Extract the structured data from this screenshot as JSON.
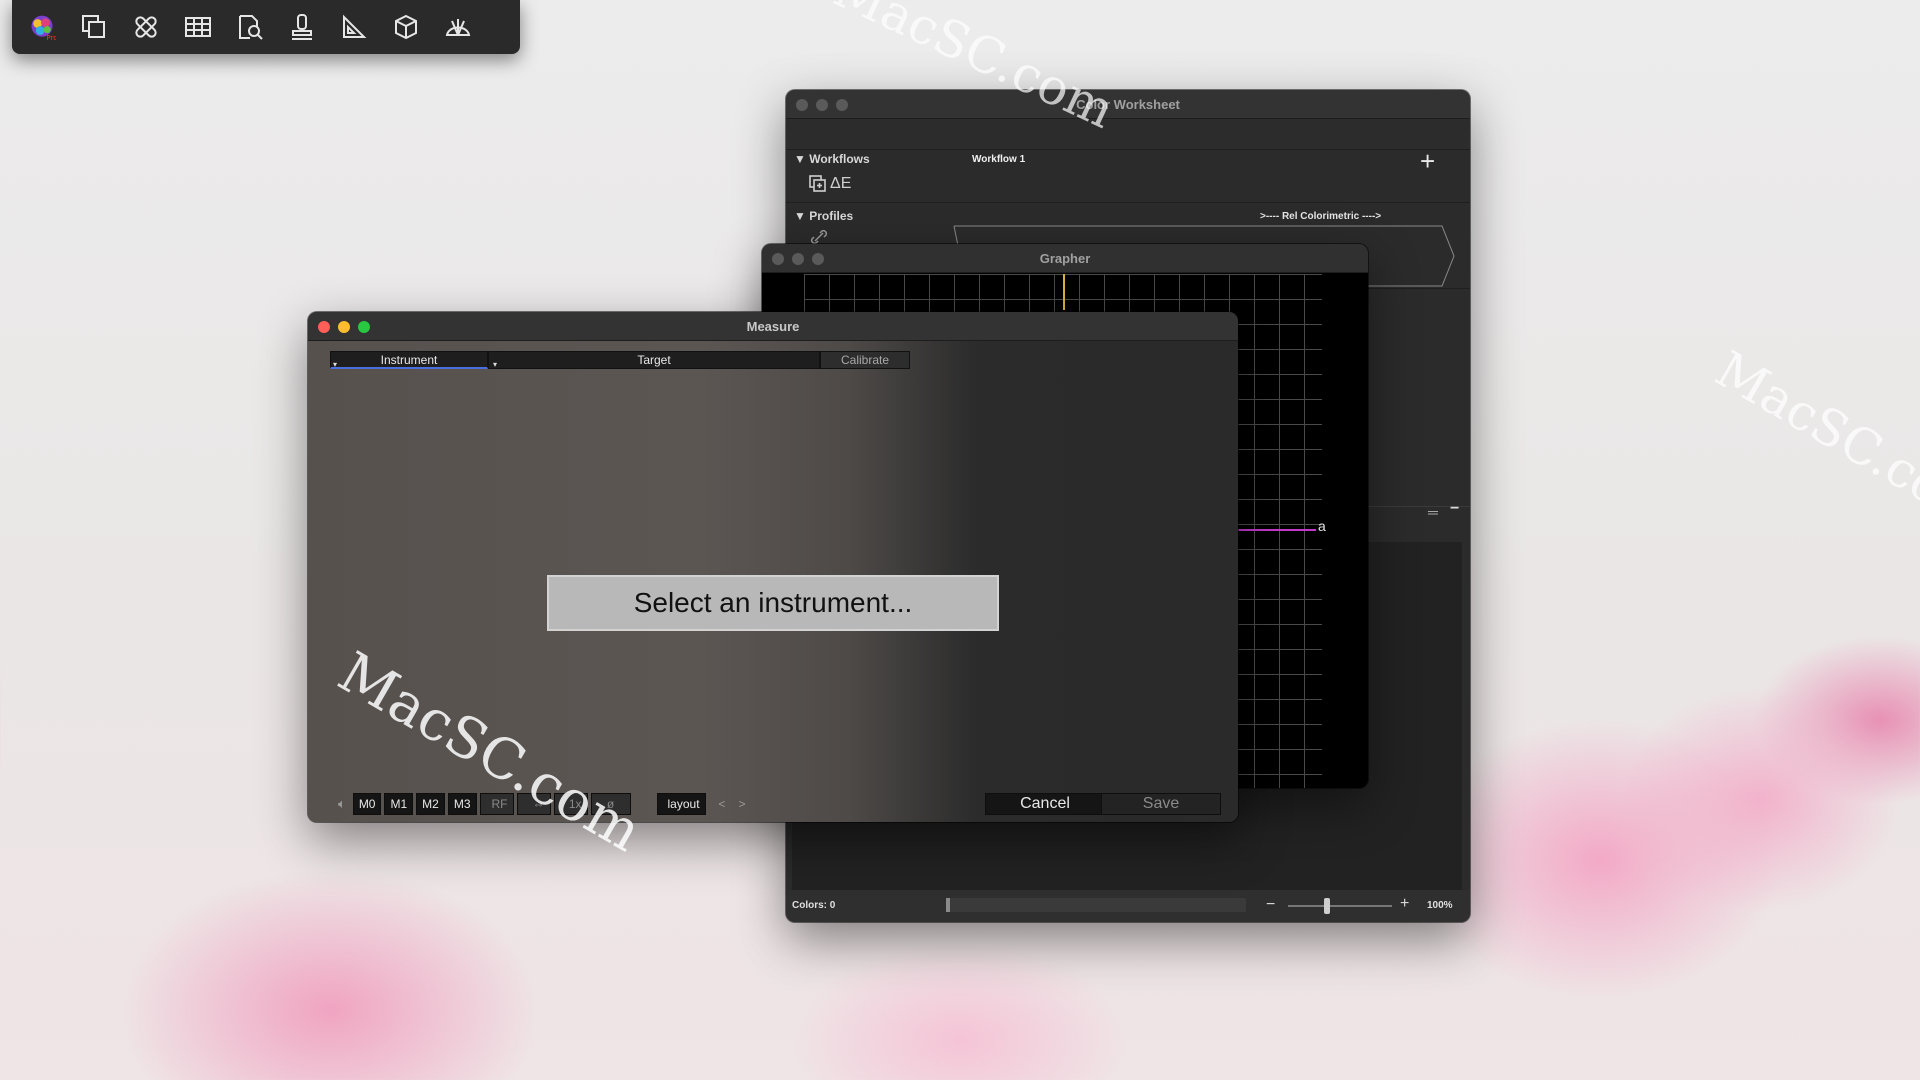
{
  "palette": {
    "tools": [
      {
        "icon": "colorful-brain-logo-icon"
      },
      {
        "icon": "stacked-windows-icon"
      },
      {
        "icon": "bandage-icon"
      },
      {
        "icon": "table-grid-icon"
      },
      {
        "icon": "document-magnifier-icon"
      },
      {
        "icon": "stamp-icon"
      },
      {
        "icon": "triangle-ruler-icon"
      },
      {
        "icon": "cube-icon"
      },
      {
        "icon": "fan-icon"
      }
    ]
  },
  "worksheet": {
    "title": "Color Worksheet",
    "workflows_label": "Workflows",
    "workflow_name": "Workflow 1",
    "delta_e": "ΔE",
    "profiles_label": "Profiles",
    "rel_colorimetric": ">---- Rel Colorimetric ---->",
    "colors_count": "Colors: 0",
    "zoom": "100%",
    "add_symbol": "+",
    "minus_symbol": "−"
  },
  "grapher": {
    "title": "Grapher",
    "marker_letter": "a"
  },
  "measure": {
    "title": "Measure",
    "tabs": {
      "instrument": "Instrument",
      "target": "Target",
      "calibrate": "Calibrate"
    },
    "prompt": "Select an instrument...",
    "modes": [
      "M0",
      "M1",
      "M2",
      "M3"
    ],
    "rf": "RF",
    "swap_icon": "⇔",
    "multiplier": "1x",
    "null_symbol": "ø",
    "layout": "layout",
    "prev": "<",
    "next": ">",
    "cancel": "Cancel",
    "save": "Save"
  },
  "watermarks": [
    "MacSC.com",
    "MacSC.com",
    "MacSC.co"
  ],
  "colors": {
    "accent_magenta": "#c23ac9",
    "marker_yellow": "#d9b43a"
  }
}
